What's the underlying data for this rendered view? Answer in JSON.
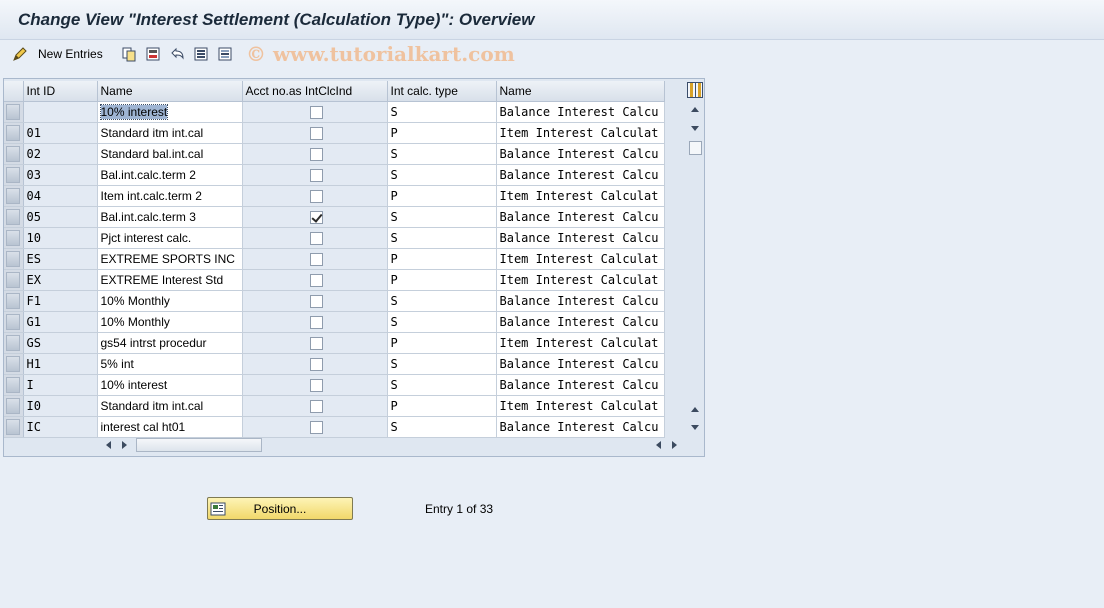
{
  "title": "Change View \"Interest Settlement (Calculation Type)\": Overview",
  "toolbar": {
    "new_entries_label": "New Entries",
    "watermark": "© www.tutorialkart.com"
  },
  "table": {
    "headers": [
      "Int ID",
      "Name",
      "Acct no.as IntClcInd",
      "Int calc. type",
      "Name"
    ],
    "rows": [
      {
        "id": "",
        "name": "10% interest",
        "acct": false,
        "type": "S",
        "calc_name": "Balance Interest Calcu"
      },
      {
        "id": "01",
        "name": "Standard itm int.cal",
        "acct": false,
        "type": "P",
        "calc_name": "Item Interest Calculat"
      },
      {
        "id": "02",
        "name": "Standard bal.int.cal",
        "acct": false,
        "type": "S",
        "calc_name": "Balance Interest Calcu"
      },
      {
        "id": "03",
        "name": "Bal.int.calc.term 2",
        "acct": false,
        "type": "S",
        "calc_name": "Balance Interest Calcu"
      },
      {
        "id": "04",
        "name": "Item int.calc.term 2",
        "acct": false,
        "type": "P",
        "calc_name": "Item Interest Calculat"
      },
      {
        "id": "05",
        "name": "Bal.int.calc.term 3",
        "acct": true,
        "type": "S",
        "calc_name": "Balance Interest Calcu"
      },
      {
        "id": "10",
        "name": "Pjct interest calc.",
        "acct": false,
        "type": "S",
        "calc_name": "Balance Interest Calcu"
      },
      {
        "id": "ES",
        "name": "EXTREME SPORTS INC",
        "acct": false,
        "type": "P",
        "calc_name": "Item Interest Calculat"
      },
      {
        "id": "EX",
        "name": "EXTREME Interest Std",
        "acct": false,
        "type": "P",
        "calc_name": "Item Interest Calculat"
      },
      {
        "id": "F1",
        "name": "10% Monthly",
        "acct": false,
        "type": "S",
        "calc_name": "Balance Interest Calcu"
      },
      {
        "id": "G1",
        "name": "10% Monthly",
        "acct": false,
        "type": "S",
        "calc_name": "Balance Interest Calcu"
      },
      {
        "id": "GS",
        "name": "gs54 intrst procedur",
        "acct": false,
        "type": "P",
        "calc_name": "Item Interest Calculat"
      },
      {
        "id": "H1",
        "name": "5% int",
        "acct": false,
        "type": "S",
        "calc_name": "Balance Interest Calcu"
      },
      {
        "id": "I",
        "name": "10% interest",
        "acct": false,
        "type": "S",
        "calc_name": "Balance Interest Calcu"
      },
      {
        "id": "I0",
        "name": "Standard itm int.cal",
        "acct": false,
        "type": "P",
        "calc_name": "Item Interest Calculat"
      },
      {
        "id": "IC",
        "name": "interest cal ht01",
        "acct": false,
        "type": "S",
        "calc_name": "Balance Interest Calcu"
      }
    ]
  },
  "footer": {
    "position_button_label": "Position...",
    "entry_info": "Entry 1 of 33"
  }
}
